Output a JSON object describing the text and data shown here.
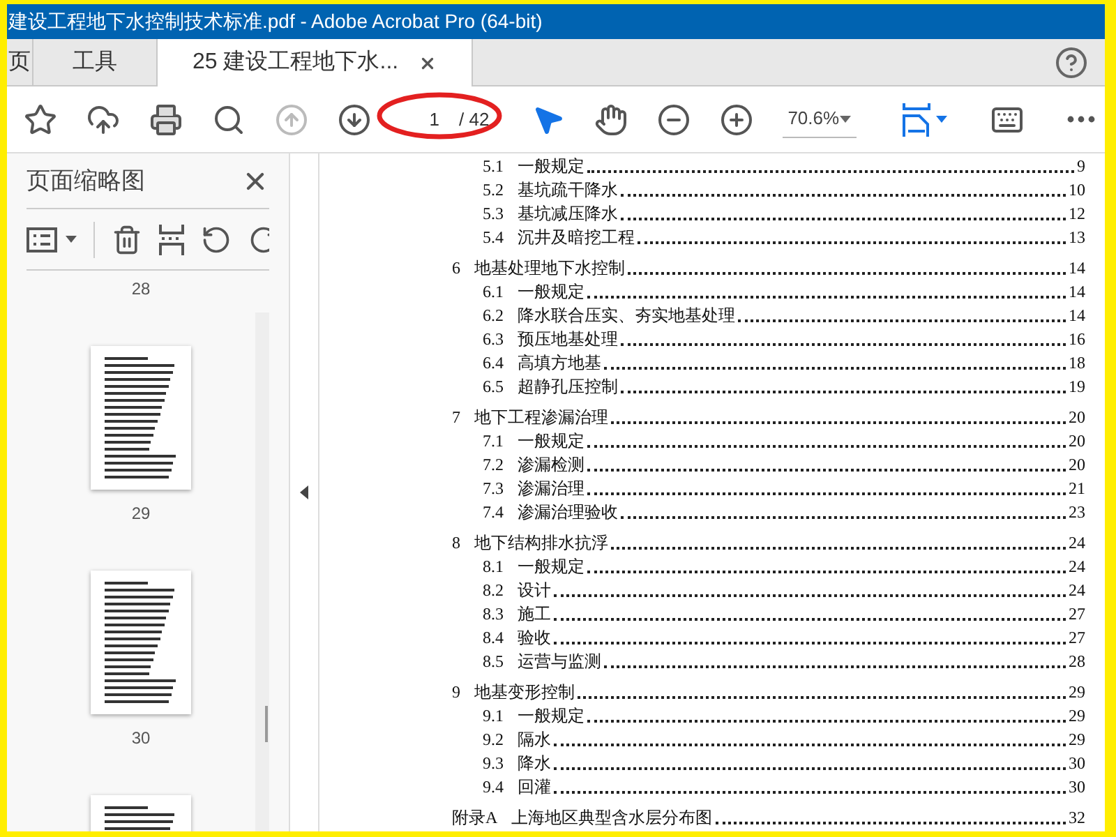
{
  "window": {
    "title": "建设工程地下水控制技术标准.pdf - Adobe Acrobat Pro (64-bit)"
  },
  "tabs": [
    {
      "label": "页",
      "selected": false
    },
    {
      "label": "工具",
      "selected": false
    },
    {
      "label": "25 建设工程地下水...",
      "selected": true
    }
  ],
  "toolbar": {
    "nav": [
      {
        "kind": "up",
        "disabled": true
      },
      {
        "kind": "down",
        "disabled": false
      }
    ],
    "page_number": "1",
    "page_count": "/ 42",
    "tools": [
      {
        "kind": "select",
        "selected": true
      },
      {
        "kind": "hand",
        "selected": false
      }
    ],
    "zoom": "70.6%"
  },
  "sidebar": {
    "title": "页面缩略图",
    "thumbnails": [
      {
        "label": "28"
      },
      {
        "label": "29"
      },
      {
        "label": "30"
      }
    ]
  },
  "toc": [
    {
      "children": [
        {
          "number": "5.1",
          "title": "一般规定",
          "page": "9"
        },
        {
          "number": "5.2",
          "title": "基坑疏干降水",
          "page": "10"
        },
        {
          "number": "5.3",
          "title": "基坑减压降水",
          "page": "12"
        },
        {
          "number": "5.4",
          "title": "沉井及暗挖工程",
          "page": "13"
        }
      ]
    },
    {
      "number": "6",
      "title": "地基处理地下水控制",
      "page": "14",
      "children": [
        {
          "number": "6.1",
          "title": "一般规定",
          "page": "14"
        },
        {
          "number": "6.2",
          "title": "降水联合压实、夯实地基处理",
          "page": "14"
        },
        {
          "number": "6.3",
          "title": "预压地基处理",
          "page": "16"
        },
        {
          "number": "6.4",
          "title": "高填方地基",
          "page": "18"
        },
        {
          "number": "6.5",
          "title": "超静孔压控制",
          "page": "19"
        }
      ]
    },
    {
      "number": "7",
      "title": "地下工程渗漏治理",
      "page": "20",
      "children": [
        {
          "number": "7.1",
          "title": "一般规定",
          "page": "20"
        },
        {
          "number": "7.2",
          "title": "渗漏检测",
          "page": "20"
        },
        {
          "number": "7.3",
          "title": "渗漏治理",
          "page": "21"
        },
        {
          "number": "7.4",
          "title": "渗漏治理验收",
          "page": "23"
        }
      ]
    },
    {
      "number": "8",
      "title": "地下结构排水抗浮",
      "page": "24",
      "children": [
        {
          "number": "8.1",
          "title": "一般规定",
          "page": "24"
        },
        {
          "number": "8.2",
          "title": "设计",
          "page": "24"
        },
        {
          "number": "8.3",
          "title": "施工",
          "page": "27"
        },
        {
          "number": "8.4",
          "title": "验收",
          "page": "27"
        },
        {
          "number": "8.5",
          "title": "运营与监测",
          "page": "28"
        }
      ]
    },
    {
      "number": "9",
      "title": "地基变形控制",
      "page": "29",
      "children": [
        {
          "number": "9.1",
          "title": "一般规定",
          "page": "29"
        },
        {
          "number": "9.2",
          "title": "隔水",
          "page": "29"
        },
        {
          "number": "9.3",
          "title": "降水",
          "page": "30"
        },
        {
          "number": "9.4",
          "title": "回灌",
          "page": "30"
        }
      ]
    },
    {
      "number": "附录A",
      "title": "上海地区典型含水层分布图",
      "page": "32"
    }
  ]
}
